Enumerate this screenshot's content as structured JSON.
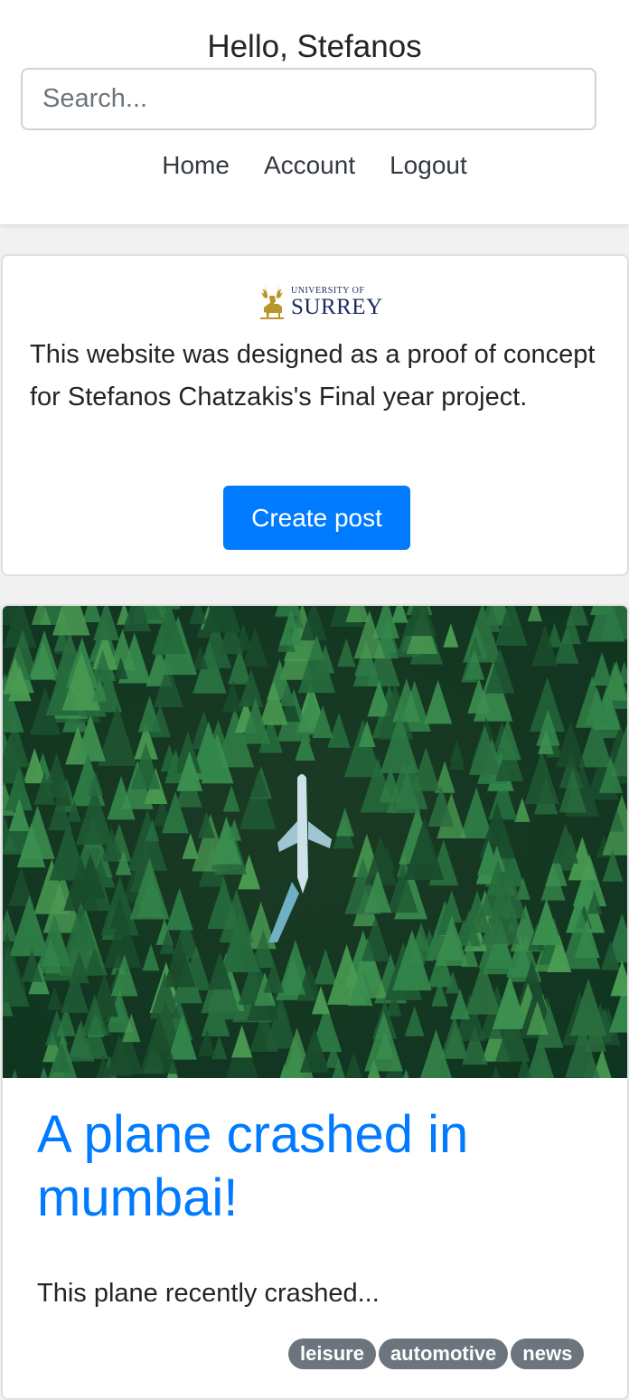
{
  "header": {
    "greeting": "Hello, Stefanos",
    "search_placeholder": "Search...",
    "nav": [
      "Home",
      "Account",
      "Logout"
    ]
  },
  "info_card": {
    "logo": {
      "line1": "UNIVERSITY OF",
      "line2": "SURREY"
    },
    "text": "This website was designed as a proof of concept for Stefanos Chatzakis's Final year project.",
    "create_button": "Create post"
  },
  "post": {
    "image": "aerial-forest-with-plane",
    "title": "A plane crashed in mumbai!",
    "excerpt": "This plane recently crashed...",
    "tags": [
      "leisure",
      "automotive",
      "news"
    ]
  },
  "colors": {
    "accent": "#007bff",
    "tag_bg": "#6c757d",
    "page_bg": "#f1f1f1",
    "logo_gold": "#b8962e",
    "logo_navy": "#1b2a5c"
  }
}
